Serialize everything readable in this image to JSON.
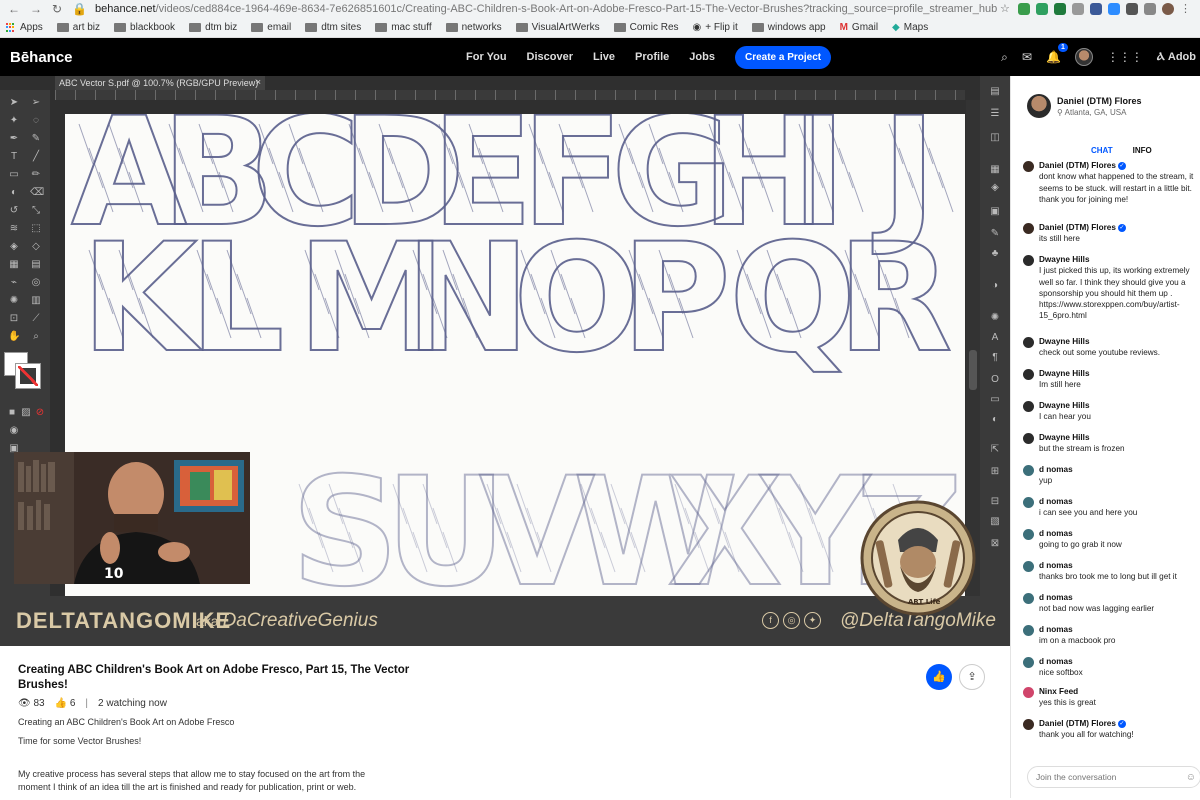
{
  "browser": {
    "url_host": "behance.net",
    "url_path": "/videos/ced884ce-1964-469e-8634-7e626851601c/Creating-ABC-Children-s-Book-Art-on-Adobe-Fresco-Part-15-The-Vector-Brushes?tracking_source=profile_streamer_hub",
    "bookmarks": [
      "Apps",
      "art biz",
      "blackbook",
      "dtm biz",
      "email",
      "dtm sites",
      "mac stuff",
      "networks",
      "VisualArtWerks",
      "Comic Res",
      "+ Flip it",
      "windows app",
      "Gmail",
      "Maps"
    ]
  },
  "behance": {
    "logo": "Bēhance",
    "nav": [
      "For You",
      "Discover",
      "Live",
      "Profile",
      "Jobs"
    ],
    "create_label": "Create a Project",
    "notification_count": "1",
    "adobe_label": "Adob"
  },
  "video": {
    "doc_tab": "ABC Vector S.pdf @ 100.7% (RGB/GPU Preview)",
    "banner_name": "DELTATANGOMIKE",
    "banner_aka": "aka",
    "banner_nick": "DaCreativeGenius",
    "banner_handle": "@DeltaTangoMike",
    "letters_row1": [
      "A",
      "B",
      "C",
      "D",
      "E",
      "F",
      "G",
      "H",
      "I",
      "J"
    ],
    "letters_row2": [
      "K",
      "L",
      "M",
      "N",
      "O",
      "P",
      "Q",
      "R"
    ],
    "letters_row3": [
      "S",
      "U",
      "V",
      "W",
      "X",
      "Y",
      "Z"
    ],
    "badge_text": "ART Life"
  },
  "info": {
    "title": "Creating ABC Children's Book Art on Adobe Fresco, Part 15, The Vector Brushes!",
    "views": "83",
    "likes": "6",
    "watching": "2 watching now",
    "desc": [
      "Creating an ABC Children's Book Art on Adobe Fresco",
      "Time for some Vector Brushes!",
      "My creative process has several steps that allow me to stay focused on the art from the moment I think of an idea till the art is finished and ready for publication, print or web."
    ]
  },
  "sidebar": {
    "profile_name": "Daniel (DTM) Flores",
    "profile_location": "Atlanta, GA, USA",
    "tab_chat": "CHAT",
    "tab_info": "INFO",
    "input_placeholder": "Join the conversation",
    "messages": [
      {
        "user": "Daniel (DTM) Flores",
        "verified": true,
        "text": "dont know what happened to the stream, it seems to be stuck. will restart in a little bit. thank you for joining me!",
        "color": "#3a2a22"
      },
      {
        "user": "Daniel (DTM) Flores",
        "verified": true,
        "text": "its still here",
        "color": "#3a2a22"
      },
      {
        "user": "Dwayne Hills",
        "verified": false,
        "text": "I just picked this up, its working extremely well so far. I think they should give you a sponsorship you should hit them up . https://www.storexppen.com/buy/artist-15_6pro.html",
        "color": "#2b2b2b"
      },
      {
        "user": "Dwayne Hills",
        "verified": false,
        "text": "check out some youtube reviews.",
        "color": "#2b2b2b"
      },
      {
        "user": "Dwayne Hills",
        "verified": false,
        "text": "Im still here",
        "color": "#2b2b2b"
      },
      {
        "user": "Dwayne Hills",
        "verified": false,
        "text": "I can hear you",
        "color": "#2b2b2b"
      },
      {
        "user": "Dwayne Hills",
        "verified": false,
        "text": "but the stream is frozen",
        "color": "#2b2b2b"
      },
      {
        "user": "d nomas",
        "verified": false,
        "text": "yup",
        "color": "#3c6f7a"
      },
      {
        "user": "d nomas",
        "verified": false,
        "text": "i can see you and here you",
        "color": "#3c6f7a"
      },
      {
        "user": "d nomas",
        "verified": false,
        "text": "going to go grab it now",
        "color": "#3c6f7a"
      },
      {
        "user": "d nomas",
        "verified": false,
        "text": "thanks bro took me to long but ill get it",
        "color": "#3c6f7a"
      },
      {
        "user": "d nomas",
        "verified": false,
        "text": "not bad now was lagging earlier",
        "color": "#3c6f7a"
      },
      {
        "user": "d nomas",
        "verified": false,
        "text": "im on a macbook pro",
        "color": "#3c6f7a"
      },
      {
        "user": "d nomas",
        "verified": false,
        "text": "nice softbox",
        "color": "#3c6f7a"
      },
      {
        "user": "Ninx Feed",
        "verified": false,
        "text": "yes this is great",
        "color": "#d0456b"
      },
      {
        "user": "Daniel (DTM) Flores",
        "verified": true,
        "text": "thank you all for watching!",
        "color": "#3a2a22"
      }
    ]
  },
  "colors": {
    "accent": "#0057ff",
    "banner_text": "#d9c9a6",
    "sketch": "#5a5f8c"
  }
}
